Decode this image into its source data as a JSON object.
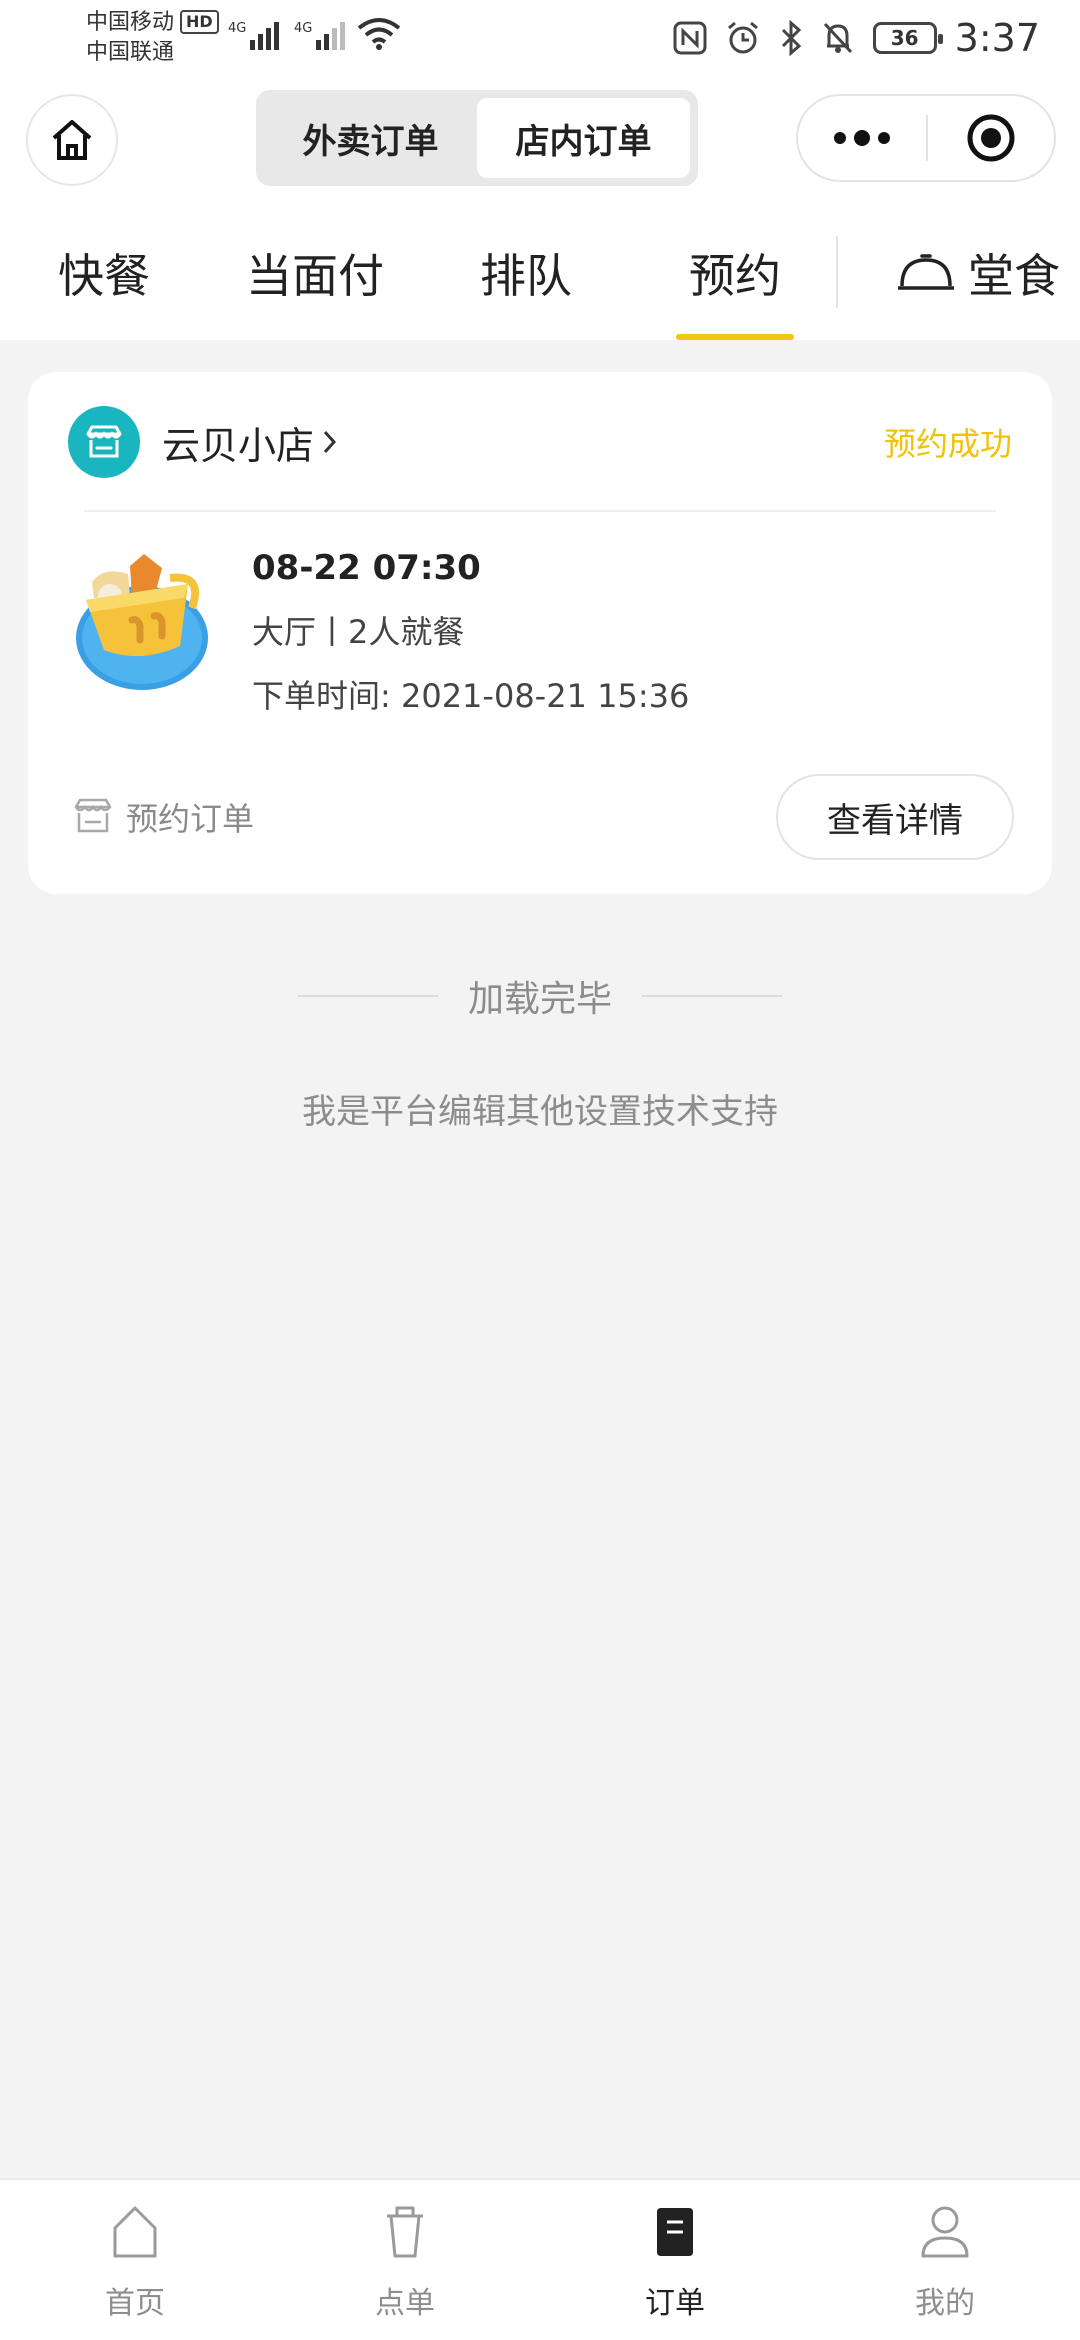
{
  "status_bar": {
    "carrier_1": "中国移动",
    "carrier_1_badge": "HD",
    "carrier_2": "中国联通",
    "network_1": "4G",
    "network_2": "4G",
    "battery": "36",
    "time": "3:37"
  },
  "header": {
    "segments": [
      {
        "label": "外卖订单",
        "active": false
      },
      {
        "label": "店内订单",
        "active": true
      }
    ]
  },
  "tabs": [
    {
      "label": "快餐",
      "active": false
    },
    {
      "label": "当面付",
      "active": false
    },
    {
      "label": "排队",
      "active": false
    },
    {
      "label": "预约",
      "active": true
    },
    {
      "label": "堂食",
      "active": false
    }
  ],
  "order": {
    "store_name": "云贝小店",
    "status": "预约成功",
    "reserve_time": "08-22 07:30",
    "seat_info": "大厅丨2人就餐",
    "order_time_label": "下单时间:",
    "order_time": "2021-08-21 15:36",
    "order_type": "预约订单",
    "detail_button": "查看详情"
  },
  "footer": {
    "loaded": "加载完毕",
    "support": "我是平台编辑其他设置技术支持"
  },
  "bottom_nav": [
    {
      "label": "首页",
      "icon": "home-icon",
      "active": false
    },
    {
      "label": "点单",
      "icon": "cup-icon",
      "active": false
    },
    {
      "label": "订单",
      "icon": "order-icon",
      "active": true
    },
    {
      "label": "我的",
      "icon": "user-icon",
      "active": false
    }
  ],
  "colors": {
    "accent": "#f0c814",
    "status_text": "#f0c20a",
    "store_icon": "#1ab6bf"
  }
}
